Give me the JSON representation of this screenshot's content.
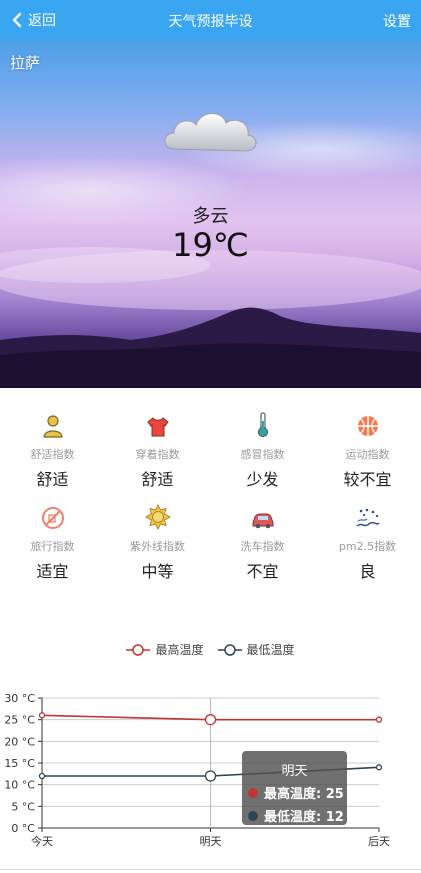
{
  "header": {
    "back_label": "返回",
    "title": "天气预报毕设",
    "settings_label": "设置"
  },
  "hero": {
    "city": "拉萨",
    "condition": "多云",
    "temperature": "19℃"
  },
  "indices": [
    {
      "icon": "person-icon",
      "label": "舒适指数",
      "value": "舒适"
    },
    {
      "icon": "shirt-icon",
      "label": "穿着指数",
      "value": "舒适"
    },
    {
      "icon": "thermometer-icon",
      "label": "感冒指数",
      "value": "少发"
    },
    {
      "icon": "ball-icon",
      "label": "运动指数",
      "value": "较不宜"
    },
    {
      "icon": "no-travel-icon",
      "label": "旅行指数",
      "value": "适宜"
    },
    {
      "icon": "sun-icon",
      "label": "紫外线指数",
      "value": "中等"
    },
    {
      "icon": "car-icon",
      "label": "洗车指数",
      "value": "不宜"
    },
    {
      "icon": "pm-icon",
      "label": "pm2.5指数",
      "value": "良"
    }
  ],
  "chart_data": {
    "type": "line",
    "categories": [
      "今天",
      "明天",
      "后天"
    ],
    "series": [
      {
        "name": "最高温度",
        "values": [
          26,
          25,
          25
        ],
        "color": "#c23531"
      },
      {
        "name": "最低温度",
        "values": [
          12,
          12,
          14
        ],
        "color": "#2f4554"
      }
    ],
    "ylim": [
      0,
      30
    ],
    "yticks": [
      "0 °C",
      "5 °C",
      "10 °C",
      "15 °C",
      "20 °C",
      "25 °C",
      "30 °C"
    ],
    "grid": true,
    "legend": "top-center",
    "tooltip": {
      "title": "明天",
      "rows": [
        "最高温度: 25",
        "最低温度: 12"
      ]
    }
  }
}
